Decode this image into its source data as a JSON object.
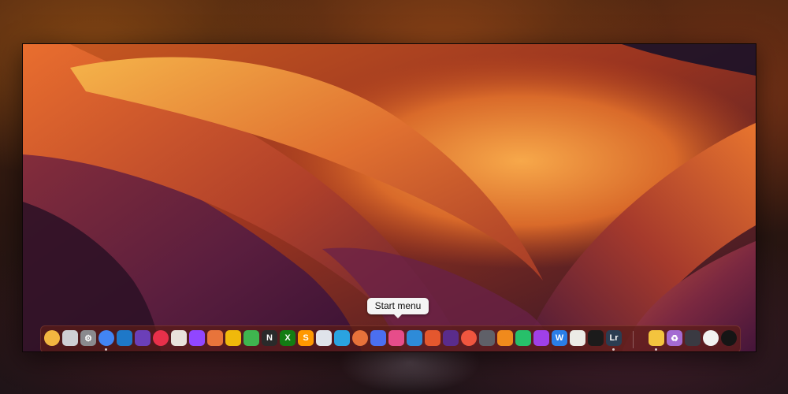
{
  "tooltip": {
    "text": "Start menu"
  },
  "dock": {
    "apps": [
      {
        "name": "emoji-icon",
        "color": "#f2b640",
        "glyph": ""
      },
      {
        "name": "overlapping-squares-icon",
        "color": "#cfcfd4",
        "glyph": ""
      },
      {
        "name": "system-preferences-icon",
        "color": "#8a8a8e",
        "glyph": "⚙"
      },
      {
        "name": "chrome-icon",
        "color": "#4285f4",
        "glyph": ""
      },
      {
        "name": "vscode-icon",
        "color": "#1e78c8",
        "glyph": ""
      },
      {
        "name": "visual-studio-icon",
        "color": "#6b3fb8",
        "glyph": ""
      },
      {
        "name": "creative-cloud-icon",
        "color": "#e8304a",
        "glyph": ""
      },
      {
        "name": "installer-icon",
        "color": "#e9e2dc",
        "glyph": ""
      },
      {
        "name": "twitch-icon",
        "color": "#9146ff",
        "glyph": ""
      },
      {
        "name": "fox-icon",
        "color": "#e8743b",
        "glyph": ""
      },
      {
        "name": "binance-icon",
        "color": "#f0b90b",
        "glyph": ""
      },
      {
        "name": "layers-icon",
        "color": "#3fb54f",
        "glyph": ""
      },
      {
        "name": "netflix-icon",
        "color": "#2a2a2a",
        "glyph": "N"
      },
      {
        "name": "xbox-icon",
        "color": "#137c13",
        "glyph": "X"
      },
      {
        "name": "sublime-text-icon",
        "color": "#ff9800",
        "glyph": "S"
      },
      {
        "name": "printer-icon",
        "color": "#dfe3ea",
        "glyph": ""
      },
      {
        "name": "telegram-icon",
        "color": "#2aa3e0",
        "glyph": ""
      },
      {
        "name": "paint-icon",
        "color": "#e7723a",
        "glyph": ""
      },
      {
        "name": "discord-icon",
        "color": "#4b6ff0",
        "glyph": ""
      },
      {
        "name": "start-menu-icon",
        "color": "#e64d8a",
        "glyph": ""
      },
      {
        "name": "cloud-icon",
        "color": "#2e8bd8",
        "glyph": ""
      },
      {
        "name": "fox-mascot-icon",
        "color": "#e4572e",
        "glyph": ""
      },
      {
        "name": "atom-icon",
        "color": "#5a2c8c",
        "glyph": ""
      },
      {
        "name": "record-icon",
        "color": "#f0563f",
        "glyph": ""
      },
      {
        "name": "prism-icon",
        "color": "#5f6068",
        "glyph": ""
      },
      {
        "name": "fruity-loops-icon",
        "color": "#f08a1c",
        "glyph": ""
      },
      {
        "name": "cross-icon",
        "color": "#27c06a",
        "glyph": ""
      },
      {
        "name": "n-logo-icon",
        "color": "#a040e8",
        "glyph": ""
      },
      {
        "name": "w-logo-icon",
        "color": "#2a7ee8",
        "glyph": "W"
      },
      {
        "name": "notes-icon",
        "color": "#ecebe6",
        "glyph": ""
      },
      {
        "name": "terminal-icon",
        "color": "#1b1b1b",
        "glyph": ""
      },
      {
        "name": "lightroom-icon",
        "color": "#2b3d52",
        "glyph": "Lr"
      },
      {
        "name": "folder-icon",
        "color": "#f3c43e",
        "glyph": ""
      },
      {
        "name": "recycle-bin-icon",
        "color": "#a46bd2",
        "glyph": "♻"
      },
      {
        "name": "window-grid-icon",
        "color": "#3a3a42",
        "glyph": ""
      },
      {
        "name": "clock-icon",
        "color": "#f2f2f2",
        "glyph": ""
      },
      {
        "name": "dark-circle-icon",
        "color": "#151515",
        "glyph": ""
      }
    ]
  }
}
